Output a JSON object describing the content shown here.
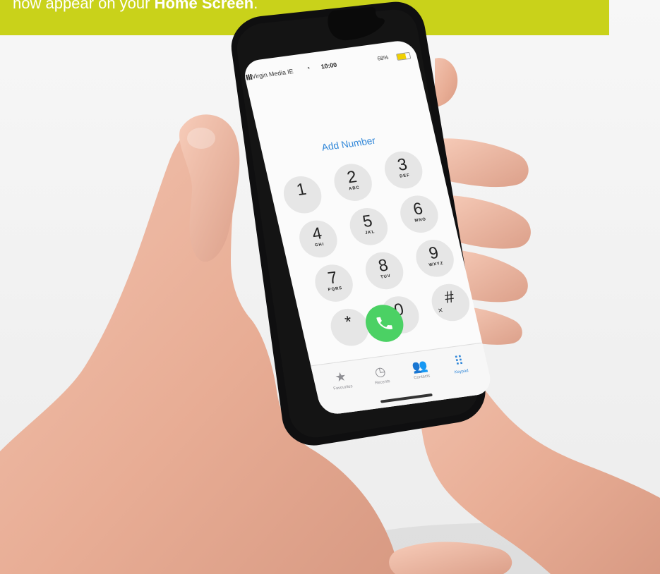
{
  "banner": {
    "text_prefix": "now appear on your ",
    "text_bold": "Home Screen",
    "text_suffix": "."
  },
  "phone": {
    "status": {
      "carrier": "Virgin Media IE",
      "time": "10:00",
      "battery": "68%"
    },
    "add_number": "Add Number",
    "keys": [
      {
        "num": "1",
        "letters": ""
      },
      {
        "num": "2",
        "letters": "ABC"
      },
      {
        "num": "3",
        "letters": "DEF"
      },
      {
        "num": "4",
        "letters": "GHI"
      },
      {
        "num": "5",
        "letters": "JKL"
      },
      {
        "num": "6",
        "letters": "MNO"
      },
      {
        "num": "7",
        "letters": "PQRS"
      },
      {
        "num": "8",
        "letters": "TUV"
      },
      {
        "num": "9",
        "letters": "WXYZ"
      },
      {
        "num": "*",
        "letters": ""
      },
      {
        "num": "0",
        "letters": "+"
      },
      {
        "num": "#",
        "letters": ""
      }
    ],
    "delete_icon": "×",
    "tabs": [
      {
        "label": "Favourites",
        "icon": "star-icon"
      },
      {
        "label": "Recents",
        "icon": "clock-icon"
      },
      {
        "label": "Contacts",
        "icon": "contacts-icon"
      },
      {
        "label": "Keypad",
        "icon": "keypad-icon"
      }
    ]
  },
  "colors": {
    "banner": "#c9d21a",
    "link": "#2f86d8",
    "call": "#4bd164"
  }
}
